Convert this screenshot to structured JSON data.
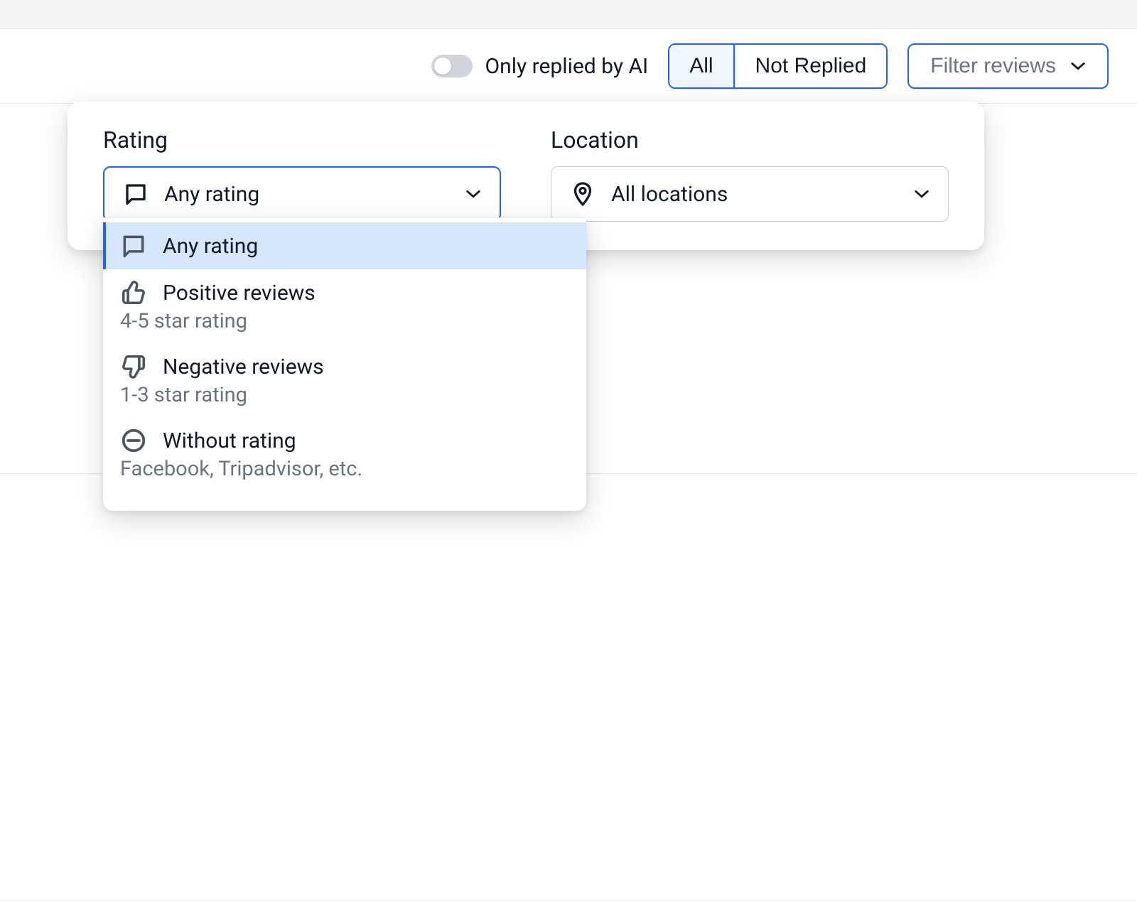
{
  "toolbar": {
    "toggle_label": "Only replied by AI",
    "seg_all": "All",
    "seg_not_replied": "Not Replied",
    "filter_label": "Filter reviews"
  },
  "popover": {
    "rating_heading": "Rating",
    "rating_value": "Any rating",
    "location_heading": "Location",
    "location_value": "All locations"
  },
  "rating_options": [
    {
      "label": "Any rating",
      "sub": ""
    },
    {
      "label": "Positive reviews",
      "sub": "4-5 star rating"
    },
    {
      "label": "Negative reviews",
      "sub": "1-3 star rating"
    },
    {
      "label": "Without rating",
      "sub": "Facebook, Tripadvisor, etc."
    }
  ]
}
